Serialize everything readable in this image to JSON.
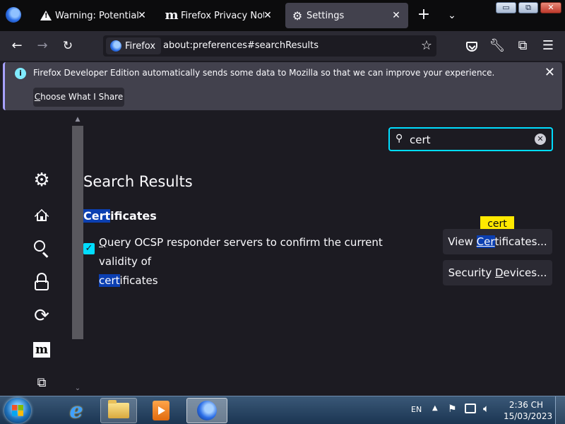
{
  "tabs": [
    {
      "title": "Warning: Potential Sec",
      "icon": "warning-icon"
    },
    {
      "title": "Firefox Privacy Notice -",
      "icon": "mozilla-m-icon"
    },
    {
      "title": "Settings",
      "icon": "gear-icon"
    }
  ],
  "window_controls": {
    "minimize": "▭",
    "maximize": "⧉",
    "close": "✕"
  },
  "toolbar": {
    "identity_label": "Firefox",
    "url": "about:preferences#searchResults"
  },
  "notification": {
    "message": "Firefox Developer Edition automatically sends some data to Mozilla so that we can improve your experience.",
    "button": {
      "prefix": "C",
      "rest": "hoose What I Share"
    }
  },
  "search": {
    "value": "cert",
    "placeholder": ""
  },
  "results": {
    "title": "Search Results",
    "heading": {
      "match": "Cert",
      "rest": "ificates"
    },
    "ocsp": {
      "checked": true,
      "first_letter": "Q",
      "text_line1": "uery OCSP responder servers to confirm the current validity of",
      "match": "cert",
      "rest": "ificates"
    },
    "view_certs": {
      "before": "View ",
      "match": "Cer",
      "rest": "tificates..."
    },
    "security_devices": {
      "before": "Security ",
      "underlined": "D",
      "rest": "evices..."
    },
    "tooltip": "cert"
  },
  "taskbar": {
    "language": "EN",
    "time": "2:36 CH",
    "date": "15/03/2023"
  },
  "colors": {
    "accent": "#00ddff",
    "highlight": "#0b3fb1",
    "tooltip": "#ffe900",
    "background": "#1c1b22"
  }
}
